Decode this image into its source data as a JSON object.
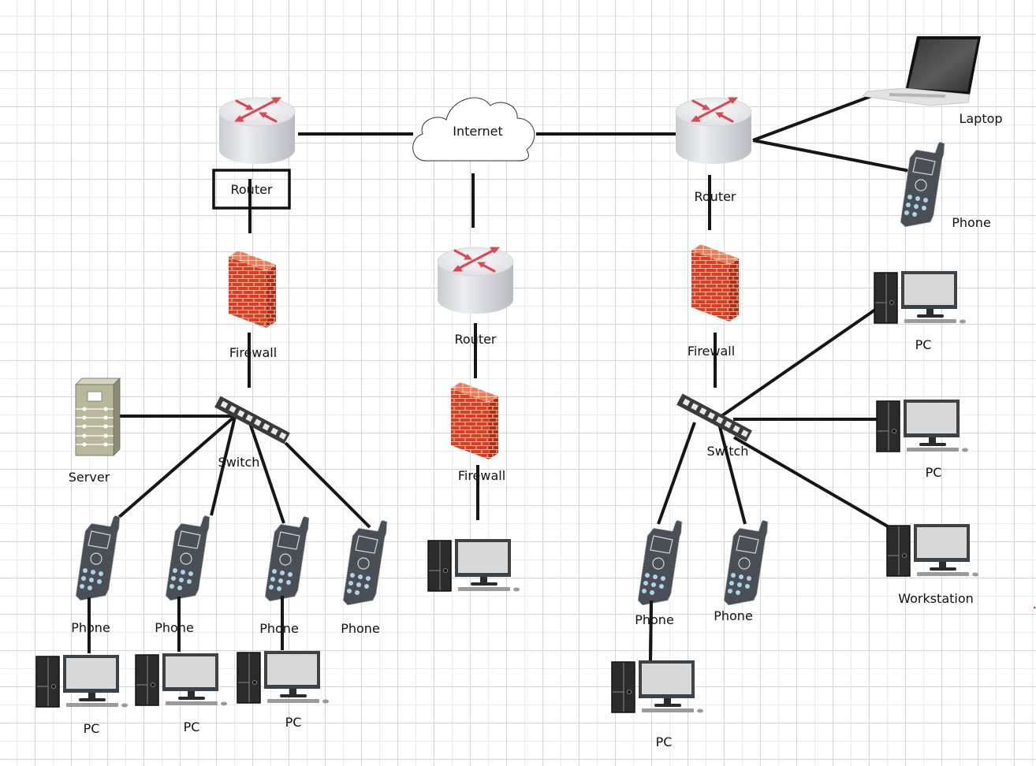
{
  "diagram": {
    "type": "network-topology",
    "colors": {
      "wire": "#161616",
      "router_arrow": "#e0454f",
      "firewall_brick": "#d9381e",
      "phone_body": "#4a4f55",
      "phone_keys": "#a9d4ea",
      "server_body": "#b9b79c",
      "pc_screen": "#d8d8d8",
      "grid": "#d4d4d4"
    },
    "nodes": [
      {
        "id": "internet",
        "type": "cloud",
        "label": "Internet"
      },
      {
        "id": "router-left",
        "type": "router",
        "label": "Router",
        "selected": true
      },
      {
        "id": "router-center",
        "type": "router",
        "label": "Router"
      },
      {
        "id": "router-right",
        "type": "router",
        "label": "Router"
      },
      {
        "id": "firewall-left",
        "type": "firewall",
        "label": "Firewall"
      },
      {
        "id": "firewall-center",
        "type": "firewall",
        "label": "Firewall"
      },
      {
        "id": "firewall-right",
        "type": "firewall",
        "label": "Firewall"
      },
      {
        "id": "switch-left",
        "type": "switch",
        "label": "Switch"
      },
      {
        "id": "switch-right",
        "type": "switch",
        "label": "Switch"
      },
      {
        "id": "server",
        "type": "server",
        "label": "Server"
      },
      {
        "id": "laptop",
        "type": "laptop",
        "label": "Laptop"
      },
      {
        "id": "phone-top-right",
        "type": "phone",
        "label": "Phone"
      },
      {
        "id": "phone-l1",
        "type": "phone",
        "label": "Phone"
      },
      {
        "id": "phone-l2",
        "type": "phone",
        "label": "Phone"
      },
      {
        "id": "phone-l3",
        "type": "phone",
        "label": "Phone"
      },
      {
        "id": "phone-l4",
        "type": "phone",
        "label": "Phone"
      },
      {
        "id": "phone-r1",
        "type": "phone",
        "label": "Phone"
      },
      {
        "id": "phone-r2",
        "type": "phone",
        "label": "Phone"
      },
      {
        "id": "pc-l1",
        "type": "pc",
        "label": "PC"
      },
      {
        "id": "pc-l2",
        "type": "pc",
        "label": "PC"
      },
      {
        "id": "pc-l3",
        "type": "pc",
        "label": "PC"
      },
      {
        "id": "pc-center",
        "type": "pc",
        "label": ""
      },
      {
        "id": "pc-r-top",
        "type": "pc",
        "label": "PC"
      },
      {
        "id": "pc-r-mid",
        "type": "pc",
        "label": "PC"
      },
      {
        "id": "workstation",
        "type": "pc",
        "label": "Workstation"
      },
      {
        "id": "pc-r-bottom",
        "type": "pc",
        "label": "PC"
      }
    ],
    "edges": [
      [
        "router-left",
        "internet"
      ],
      [
        "internet",
        "router-right"
      ],
      [
        "internet",
        "router-center"
      ],
      [
        "router-left",
        "firewall-left"
      ],
      [
        "firewall-left",
        "switch-left"
      ],
      [
        "switch-left",
        "server"
      ],
      [
        "switch-left",
        "phone-l1"
      ],
      [
        "switch-left",
        "phone-l2"
      ],
      [
        "switch-left",
        "phone-l3"
      ],
      [
        "switch-left",
        "phone-l4"
      ],
      [
        "phone-l1",
        "pc-l1"
      ],
      [
        "phone-l2",
        "pc-l2"
      ],
      [
        "phone-l3",
        "pc-l3"
      ],
      [
        "router-center",
        "firewall-center"
      ],
      [
        "firewall-center",
        "pc-center"
      ],
      [
        "router-right",
        "laptop"
      ],
      [
        "router-right",
        "phone-top-right"
      ],
      [
        "router-right",
        "firewall-right"
      ],
      [
        "firewall-right",
        "switch-right"
      ],
      [
        "switch-right",
        "pc-r-top"
      ],
      [
        "switch-right",
        "pc-r-mid"
      ],
      [
        "switch-right",
        "workstation"
      ],
      [
        "switch-right",
        "phone-r1"
      ],
      [
        "switch-right",
        "phone-r2"
      ],
      [
        "phone-r1",
        "pc-r-bottom"
      ]
    ]
  }
}
